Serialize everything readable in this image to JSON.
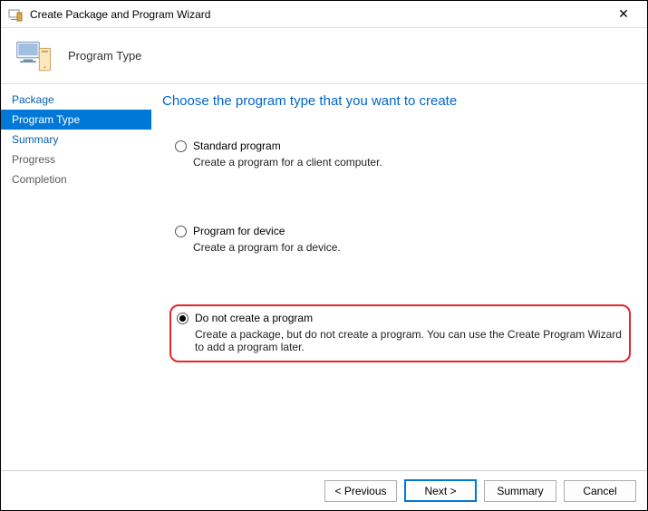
{
  "window": {
    "title": "Create Package and Program Wizard",
    "close_glyph": "✕"
  },
  "header": {
    "page_title": "Program Type"
  },
  "sidebar": {
    "items": [
      {
        "label": "Package",
        "state": "link"
      },
      {
        "label": "Program Type",
        "state": "active"
      },
      {
        "label": "Summary",
        "state": "link"
      },
      {
        "label": "Progress",
        "state": "disabled"
      },
      {
        "label": "Completion",
        "state": "disabled"
      }
    ]
  },
  "content": {
    "heading": "Choose the program type that you want to create",
    "options": [
      {
        "id": "standard",
        "label": "Standard program",
        "description": "Create a program for a client computer.",
        "checked": false,
        "highlight": false
      },
      {
        "id": "device",
        "label": "Program for device",
        "description": "Create a program for a device.",
        "checked": false,
        "highlight": false
      },
      {
        "id": "none",
        "label": "Do not create a program",
        "description": "Create a package, but do not create a program. You can use the Create Program Wizard to add a program later.",
        "checked": true,
        "highlight": true
      }
    ]
  },
  "footer": {
    "previous": "< Previous",
    "next": "Next >",
    "summary": "Summary",
    "cancel": "Cancel"
  }
}
